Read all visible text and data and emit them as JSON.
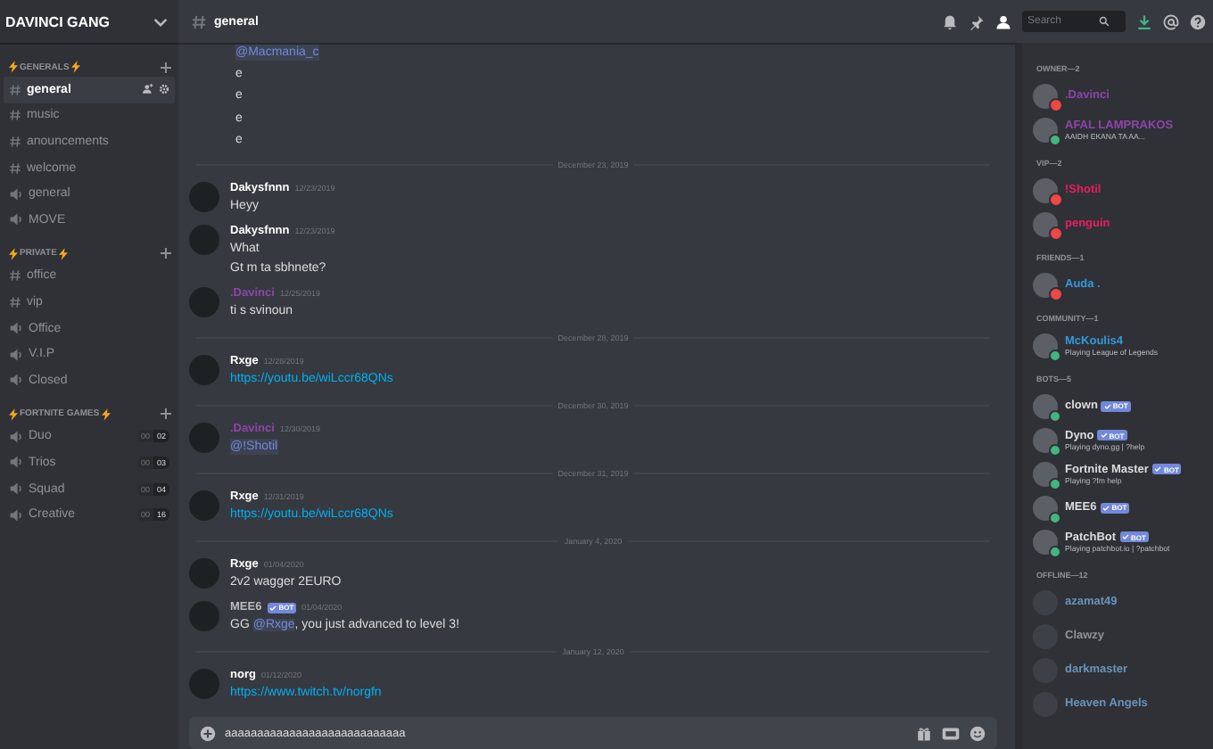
{
  "server": {
    "name": "DAVINCI GANG"
  },
  "categories": [
    {
      "name": "GENERALS",
      "channels": [
        {
          "kind": "text",
          "name": "general",
          "selected": true
        },
        {
          "kind": "text",
          "name": "music",
          "selected": false
        },
        {
          "kind": "text",
          "name": "anouncements",
          "selected": false
        },
        {
          "kind": "text",
          "name": "welcome",
          "selected": false
        },
        {
          "kind": "voice",
          "name": "general",
          "selected": false
        },
        {
          "kind": "voice",
          "name": "MOVE",
          "selected": false
        }
      ]
    },
    {
      "name": "PRIVATE",
      "channels": [
        {
          "kind": "text",
          "name": "office",
          "selected": false
        },
        {
          "kind": "text",
          "name": "vip",
          "selected": false
        },
        {
          "kind": "voice",
          "name": "Office",
          "selected": false
        },
        {
          "kind": "voice",
          "name": "V.I.P",
          "selected": false
        },
        {
          "kind": "voice",
          "name": "Closed",
          "selected": false
        }
      ]
    },
    {
      "name": "FORTNITE GAMES",
      "channels": [
        {
          "kind": "voice",
          "name": "Duo",
          "selected": false,
          "count": "00",
          "limit": "02"
        },
        {
          "kind": "voice",
          "name": "Trios",
          "selected": false,
          "count": "00",
          "limit": "03"
        },
        {
          "kind": "voice",
          "name": "Squad",
          "selected": false,
          "count": "00",
          "limit": "04"
        },
        {
          "kind": "voice",
          "name": "Creative",
          "selected": false,
          "count": "00",
          "limit": "16"
        }
      ]
    }
  ],
  "channel": {
    "name": "general"
  },
  "search": {
    "placeholder": "Search"
  },
  "messages": [
    {
      "kind": "continuation",
      "lines": [
        [
          {
            "kind": "mention",
            "text": "@Macmania_c"
          }
        ],
        [
          {
            "kind": "text",
            "text": "e"
          }
        ],
        [
          {
            "kind": "text",
            "text": "e"
          }
        ],
        [
          {
            "kind": "text",
            "text": "e"
          }
        ],
        [
          {
            "kind": "text",
            "text": "e"
          }
        ]
      ]
    },
    {
      "kind": "divider",
      "text": "December 23, 2019"
    },
    {
      "kind": "message",
      "author": "Dakysfnnn",
      "color": "#ffffff",
      "time": "12/23/2019",
      "lines": [
        [
          {
            "kind": "text",
            "text": "Heyy"
          }
        ]
      ]
    },
    {
      "kind": "message",
      "author": "Dakysfnnn",
      "color": "#ffffff",
      "time": "12/23/2019",
      "lines": [
        [
          {
            "kind": "text",
            "text": "What"
          }
        ],
        [
          {
            "kind": "text",
            "text": "Gt m ta sbhnete?"
          }
        ]
      ]
    },
    {
      "kind": "message",
      "author": ".Davinci",
      "color": "#8e44ad",
      "time": "12/25/2019",
      "lines": [
        [
          {
            "kind": "text",
            "text": "ti s svinoun"
          }
        ]
      ]
    },
    {
      "kind": "divider",
      "text": "December 28, 2019"
    },
    {
      "kind": "message",
      "author": "Rxge",
      "color": "#ffffff",
      "time": "12/28/2019",
      "lines": [
        [
          {
            "kind": "link",
            "text": "https://youtu.be/wiLccr68QNs"
          }
        ]
      ]
    },
    {
      "kind": "divider",
      "text": "December 30, 2019"
    },
    {
      "kind": "message",
      "author": ".Davinci",
      "color": "#8e44ad",
      "time": "12/30/2019",
      "lines": [
        [
          {
            "kind": "mention",
            "text": "@!Shotil"
          }
        ]
      ]
    },
    {
      "kind": "divider",
      "text": "December 31, 2019"
    },
    {
      "kind": "message",
      "author": "Rxge",
      "color": "#ffffff",
      "time": "12/31/2019",
      "lines": [
        [
          {
            "kind": "link",
            "text": "https://youtu.be/wiLccr68QNs"
          }
        ]
      ]
    },
    {
      "kind": "divider",
      "text": "January 4, 2020"
    },
    {
      "kind": "message",
      "author": "Rxge",
      "color": "#ffffff",
      "time": "01/04/2020",
      "lines": [
        [
          {
            "kind": "text",
            "text": "2v2 wagger 2EURO"
          }
        ]
      ]
    },
    {
      "kind": "message",
      "author": "MEE6",
      "color": "#b9bbbe",
      "time": "01/04/2020",
      "bot": "BOT",
      "lines": [
        [
          {
            "kind": "text",
            "text": "GG "
          },
          {
            "kind": "mention",
            "text": "@Rxge"
          },
          {
            "kind": "text",
            "text": ", you just advanced to level 3!"
          }
        ]
      ]
    },
    {
      "kind": "divider",
      "text": "January 12, 2020"
    },
    {
      "kind": "message",
      "author": "norg",
      "color": "#ffffff",
      "time": "01/12/2020",
      "lines": [
        [
          {
            "kind": "link",
            "text": "https://www.twitch.tv/norgfn"
          }
        ]
      ]
    }
  ],
  "composer": {
    "value": "aaaaaaaaaaaaaaaaaaaaaaaaaaaa"
  },
  "member_groups": [
    {
      "name": "OWNER—2",
      "members": [
        {
          "name": ".Davinci",
          "color": "#8e44ad",
          "online": true,
          "dnd": true
        },
        {
          "name": "AFAL LAMPRAKOS",
          "color": "#8e44ad",
          "online": true,
          "dnd": false,
          "activity": "AAIDH EKANA TA AA..."
        }
      ]
    },
    {
      "name": "VIP—2",
      "members": [
        {
          "name": "!Shotil",
          "color": "#e91e63",
          "online": true,
          "dnd": true
        },
        {
          "name": "penguin",
          "color": "#e91e63",
          "online": true,
          "dnd": true
        }
      ]
    },
    {
      "name": "FRIENDS—1",
      "members": [
        {
          "name": "Auda .",
          "color": "#3498db",
          "online": true,
          "dnd": true
        }
      ]
    },
    {
      "name": "COMMUNITY—1",
      "members": [
        {
          "name": "McKoulis4",
          "color": "#3498db",
          "online": true,
          "dnd": false,
          "activity": "Playing League of Legends"
        }
      ]
    },
    {
      "name": "BOTS—5",
      "members": [
        {
          "name": "clown",
          "color": "#dcddde",
          "online": true,
          "dnd": false,
          "bot": "BOT"
        },
        {
          "name": "Dyno",
          "color": "#dcddde",
          "online": true,
          "dnd": false,
          "bot": "BOT",
          "activity": "Playing dyno.gg | ?help"
        },
        {
          "name": "Fortnite Master",
          "color": "#dcddde",
          "online": true,
          "dnd": false,
          "bot": "BOT",
          "activity": "Playing ?fm help"
        },
        {
          "name": "MEE6",
          "color": "#dcddde",
          "online": true,
          "dnd": false,
          "bot": "BOT"
        },
        {
          "name": "PatchBot",
          "color": "#dcddde",
          "online": true,
          "dnd": false,
          "bot": "BOT",
          "activity": "Playing patchbot.io | ?patchbot"
        }
      ]
    },
    {
      "name": "OFFLINE—12",
      "members": [
        {
          "name": "azamat49",
          "color": "#6a93bb",
          "online": false,
          "dnd": false
        },
        {
          "name": "Clawzy",
          "color": "#8e9297",
          "online": false,
          "dnd": false
        },
        {
          "name": "darkmaster",
          "color": "#6a93bb",
          "online": false,
          "dnd": false
        },
        {
          "name": "Heaven Angels",
          "color": "#6a93bb",
          "online": false,
          "dnd": false
        }
      ]
    }
  ]
}
